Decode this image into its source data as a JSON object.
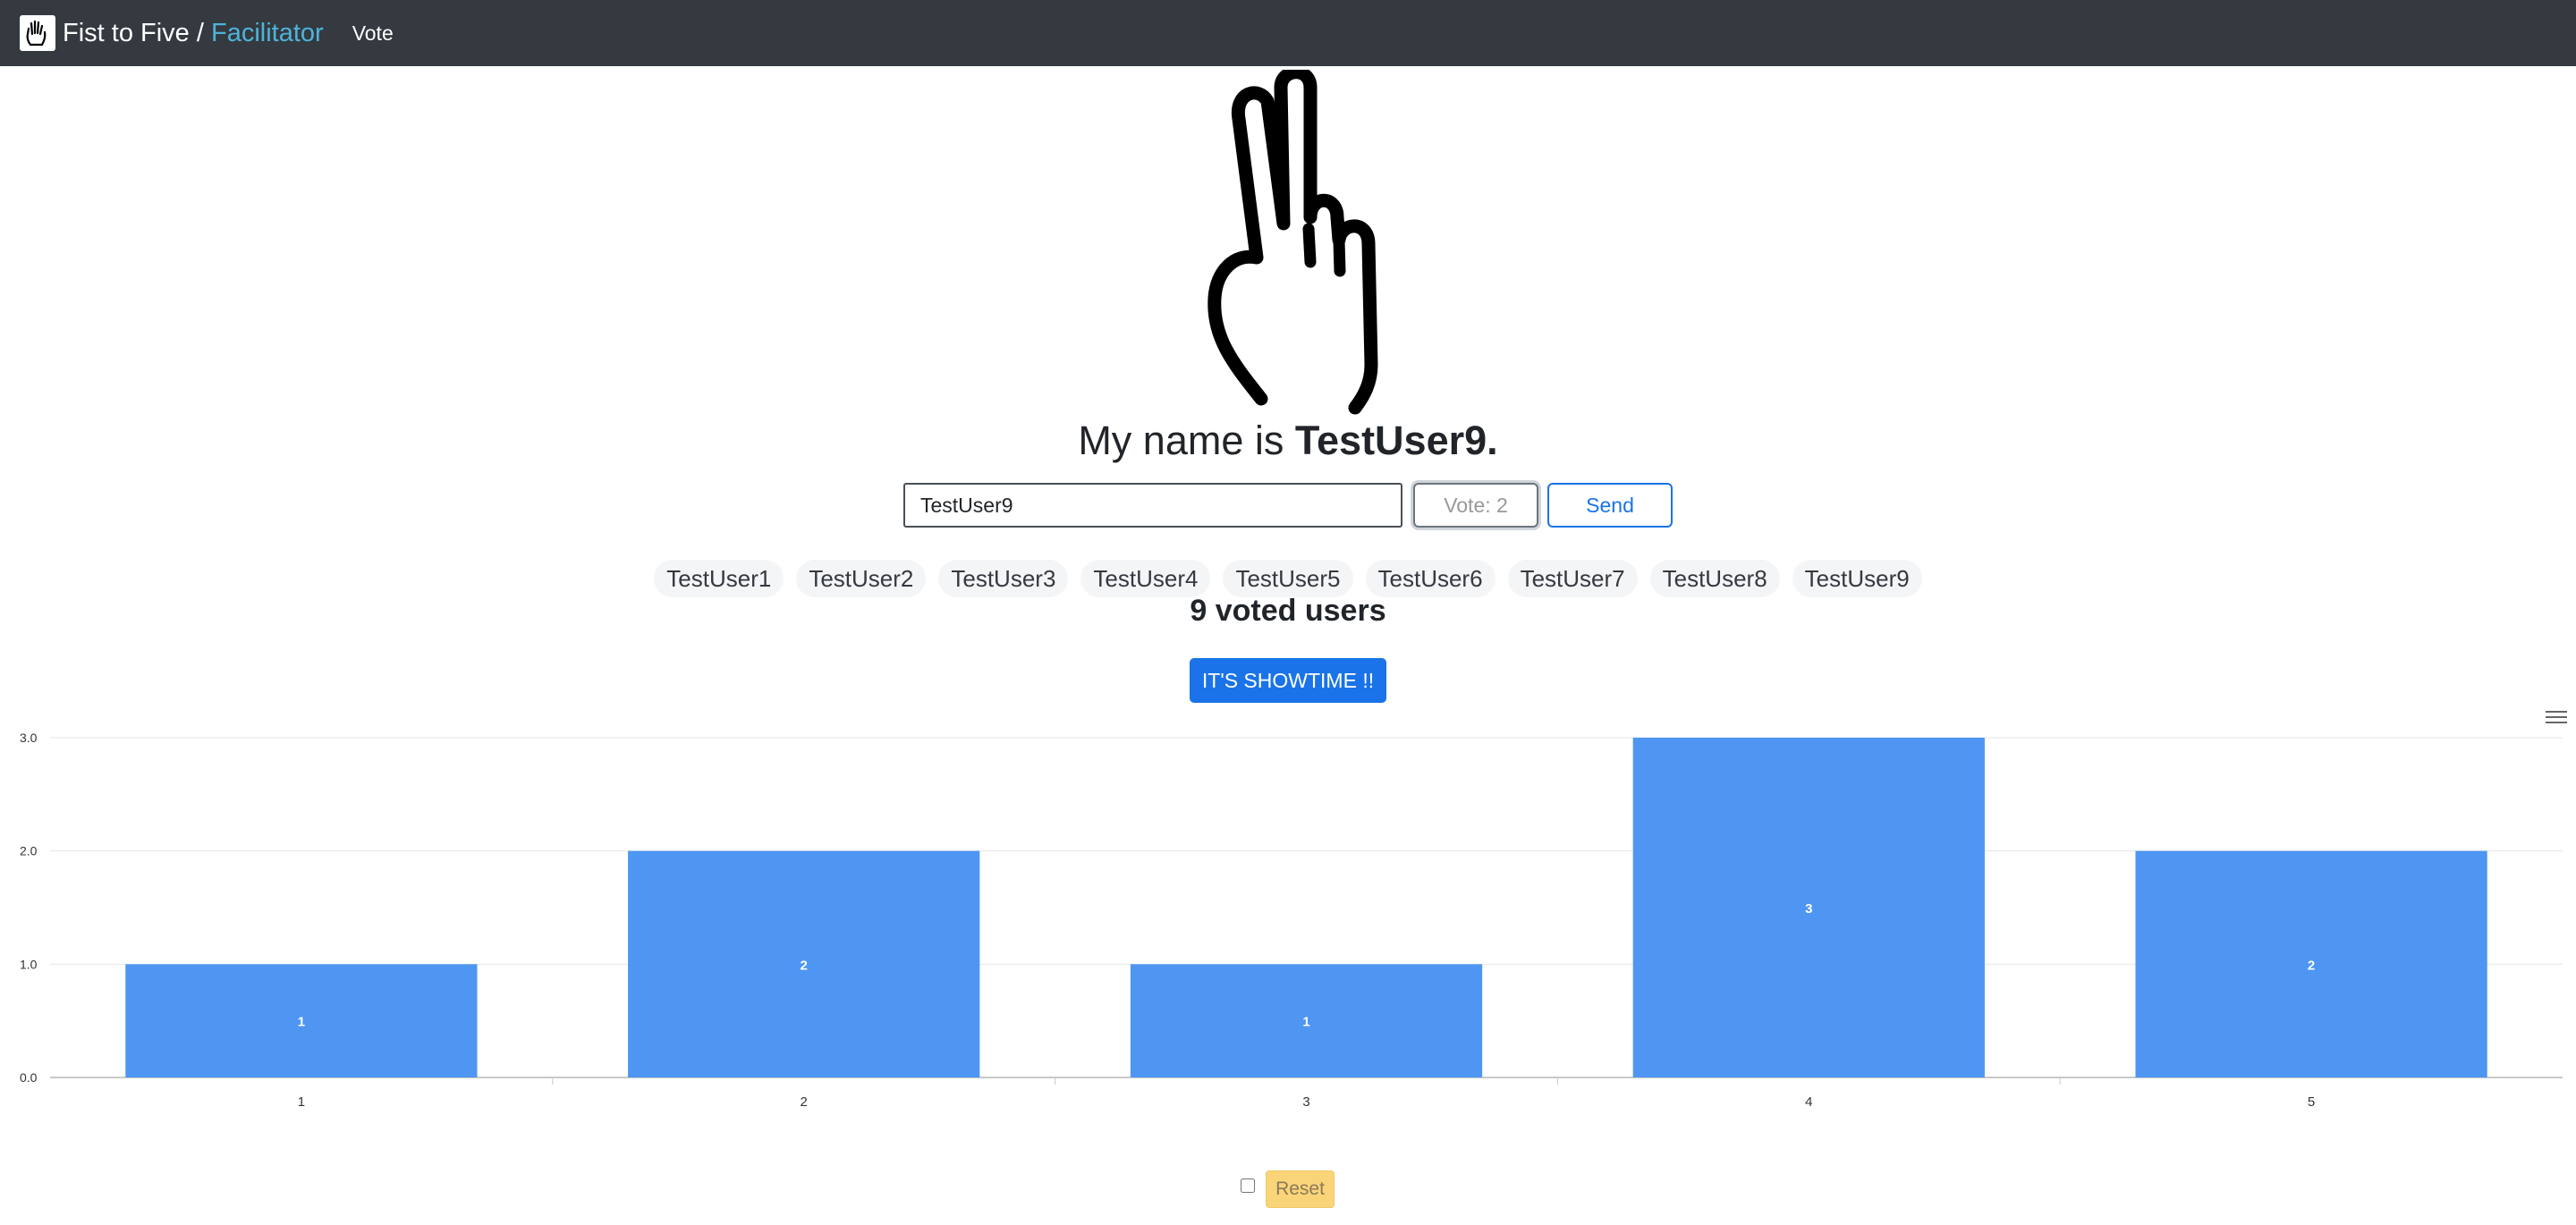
{
  "navbar": {
    "brand_prefix": "Fist to Five / ",
    "brand_accent": "Facilitator",
    "vote_link": "Vote"
  },
  "title": {
    "prefix": "My name is ",
    "name": "TestUser9",
    "suffix": "."
  },
  "form": {
    "name_value": "TestUser9",
    "vote_placeholder": "Vote: 2",
    "send_label": "Send"
  },
  "users": [
    "TestUser1",
    "TestUser2",
    "TestUser3",
    "TestUser4",
    "TestUser5",
    "TestUser6",
    "TestUser7",
    "TestUser8",
    "TestUser9"
  ],
  "voted_text": "9 voted users",
  "showtime_label": "IT'S SHOWTIME !!",
  "reset_label": "Reset",
  "colors": {
    "bar": "#4f96f3",
    "accent": "#1a73e8",
    "navbar": "#343a40"
  },
  "chart_data": {
    "type": "bar",
    "categories": [
      "1",
      "2",
      "3",
      "4",
      "5"
    ],
    "values": [
      1,
      2,
      1,
      3,
      2
    ],
    "ylim": [
      0,
      3
    ],
    "yticks": [
      "0.0",
      "1.0",
      "2.0",
      "3.0"
    ],
    "data_labels": true,
    "grid": true,
    "title": "",
    "xlabel": "",
    "ylabel": ""
  }
}
